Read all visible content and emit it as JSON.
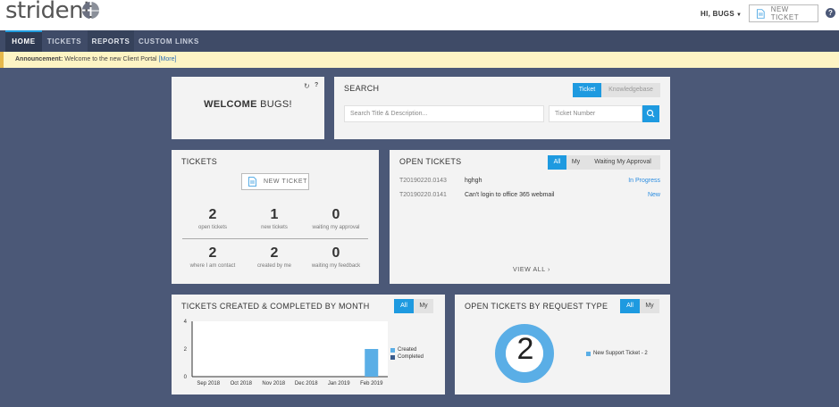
{
  "header": {
    "logo_text": "strident",
    "user_menu": "HI, BUGS",
    "new_ticket_label": "NEW TICKET",
    "help_label": "?"
  },
  "nav": {
    "items": [
      "HOME",
      "TICKETS",
      "REPORTS",
      "CUSTOM LINKS"
    ],
    "active": "HOME"
  },
  "announcement": {
    "label": "Announcement:",
    "text": "Welcome to the new Client Portal",
    "more": "[More]"
  },
  "welcome": {
    "prefix": "WELCOME",
    "name": "BUGS!"
  },
  "search": {
    "title": "SEARCH",
    "tabs": [
      "Ticket",
      "Knowledgebase"
    ],
    "active_tab": "Ticket",
    "desc_placeholder": "Search Title & Description...",
    "number_placeholder": "Ticket Number"
  },
  "tickets": {
    "title": "TICKETS",
    "new_ticket_label": "NEW TICKET",
    "stats": [
      {
        "value": "2",
        "label": "open tickets"
      },
      {
        "value": "1",
        "label": "new tickets"
      },
      {
        "value": "0",
        "label": "waiting my approval"
      },
      {
        "value": "2",
        "label": "where I am contact"
      },
      {
        "value": "2",
        "label": "created by me"
      },
      {
        "value": "0",
        "label": "waiting my feedback"
      }
    ]
  },
  "open_tickets": {
    "title": "OPEN TICKETS",
    "filters": [
      "All",
      "My",
      "Waiting My Approval"
    ],
    "active_filter": "All",
    "rows": [
      {
        "id": "T20190220.0143",
        "desc": "hghgh",
        "status": "In Progress"
      },
      {
        "id": "T20190220.0141",
        "desc": "Can't login to office 365 webmail",
        "status": "New"
      }
    ],
    "view_all": "VIEW ALL ›"
  },
  "chart_month": {
    "title": "TICKETS CREATED & COMPLETED BY MONTH",
    "filters": [
      "All",
      "My"
    ],
    "active_filter": "All"
  },
  "chart_type": {
    "title": "OPEN TICKETS BY REQUEST TYPE",
    "filters": [
      "All",
      "My"
    ],
    "active_filter": "All"
  },
  "chart_data": [
    {
      "type": "bar",
      "categories": [
        "Sep 2018",
        "Oct 2018",
        "Nov 2018",
        "Dec 2018",
        "Jan 2019",
        "Feb 2019"
      ],
      "series": [
        {
          "name": "Created",
          "values": [
            0,
            0,
            0,
            0,
            0,
            2
          ],
          "color": "#5aaee6"
        },
        {
          "name": "Completed",
          "values": [
            0,
            0,
            0,
            0,
            0,
            0
          ],
          "color": "#3a5b8c"
        }
      ],
      "title": "TICKETS CREATED & COMPLETED BY MONTH",
      "ylim": [
        0,
        4
      ],
      "yticks": [
        "0",
        "2",
        "4"
      ],
      "legend": "right"
    },
    {
      "type": "pie",
      "donut": true,
      "center_label": "2",
      "slices": [
        {
          "name": "New Support Ticket - 2",
          "value": 2,
          "color": "#5aaee6"
        }
      ],
      "title": "OPEN TICKETS BY REQUEST TYPE",
      "legend": "right"
    }
  ],
  "colors": {
    "accent": "#1e9ae0",
    "page_bg": "#4b5877",
    "nav_bg": "#3f4b67",
    "link": "#2c8de0"
  }
}
